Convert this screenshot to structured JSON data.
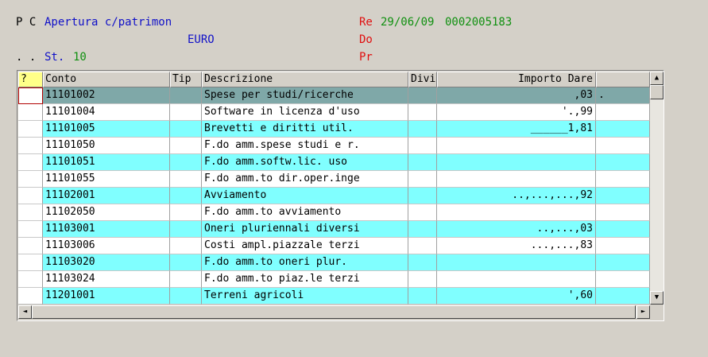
{
  "header": {
    "flags": "P C",
    "title": "Apertura c/patrimon",
    "currency": "EURO",
    "dots": ". .",
    "st_label": "St.",
    "st_value": "10",
    "re_label": "Re",
    "date": "29/06/09",
    "doc_number": "0002005183",
    "do_label": "Do",
    "pr_label": "Pr"
  },
  "grid": {
    "columns": [
      "?",
      "Conto",
      "Tip",
      "Descrizione",
      "Divi",
      "Importo Dare",
      ""
    ],
    "rows": [
      {
        "conto": "11101002",
        "tip": "",
        "descrizione": "Spese per studi/ricerche",
        "divi": "",
        "importo": ",03",
        "extra": ".",
        "color": "#7fa8a8"
      },
      {
        "conto": "11101004",
        "tip": "",
        "descrizione": "Software in licenza d'uso",
        "divi": "",
        "importo": "'.,99",
        "extra": "",
        "color": "#ffffff"
      },
      {
        "conto": "11101005",
        "tip": "",
        "descrizione": "Brevetti e diritti util.",
        "divi": "",
        "importo": "______1,81",
        "extra": "",
        "color": "#80ffff"
      },
      {
        "conto": "11101050",
        "tip": "",
        "descrizione": "F.do amm.spese studi e r.",
        "divi": "",
        "importo": "",
        "extra": "",
        "color": "#ffffff"
      },
      {
        "conto": "11101051",
        "tip": "",
        "descrizione": "F.do amm.softw.lic. uso",
        "divi": "",
        "importo": "",
        "extra": "",
        "color": "#80ffff"
      },
      {
        "conto": "11101055",
        "tip": "",
        "descrizione": "F.do amm.to dir.oper.inge",
        "divi": "",
        "importo": "",
        "extra": "",
        "color": "#ffffff"
      },
      {
        "conto": "11102001",
        "tip": "",
        "descrizione": "Avviamento",
        "divi": "",
        "importo": "..,...,...,92",
        "extra": "",
        "color": "#80ffff"
      },
      {
        "conto": "11102050",
        "tip": "",
        "descrizione": "F.do amm.to avviamento",
        "divi": "",
        "importo": "",
        "extra": "",
        "color": "#ffffff"
      },
      {
        "conto": "11103001",
        "tip": "",
        "descrizione": "Oneri pluriennali diversi",
        "divi": "",
        "importo": "..,...,03",
        "extra": "",
        "color": "#80ffff"
      },
      {
        "conto": "11103006",
        "tip": "",
        "descrizione": "Costi ampl.piazzale terzi",
        "divi": "",
        "importo": "...,...,83",
        "extra": "",
        "color": "#ffffff"
      },
      {
        "conto": "11103020",
        "tip": "",
        "descrizione": "F.do amm.to oneri plur.",
        "divi": "",
        "importo": "",
        "extra": "",
        "color": "#80ffff"
      },
      {
        "conto": "11103024",
        "tip": "",
        "descrizione": "F.do amm.to piaz.le terzi",
        "divi": "",
        "importo": "",
        "extra": "",
        "color": "#ffffff"
      },
      {
        "conto": "11201001",
        "tip": "",
        "descrizione": "Terreni agricoli",
        "divi": "",
        "importo": "',60",
        "extra": "",
        "color": "#80ffff"
      }
    ]
  },
  "scroll": {
    "up": "▲",
    "down": "▼",
    "left": "◄",
    "right": "►"
  }
}
